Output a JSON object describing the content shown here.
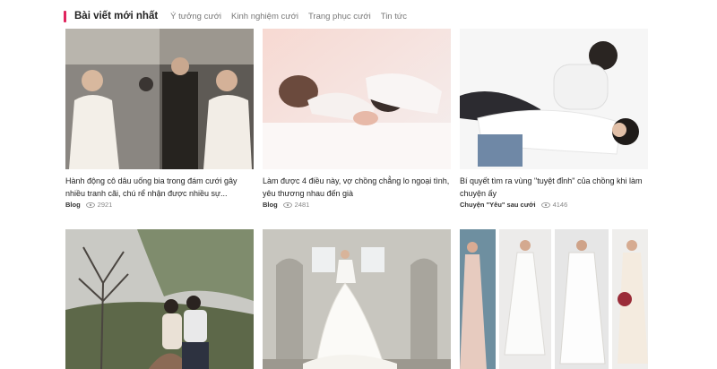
{
  "section": {
    "title": "Bài viết mới nhất",
    "tabs": [
      "Ý tưởng cưới",
      "Kinh nghiệm cưới",
      "Trang phục cưới",
      "Tin tức"
    ]
  },
  "articles": [
    {
      "title": "Hành động cô dâu uống bia trong đám cưới gây nhiều tranh cãi, chú rể nhận được nhiều sự...",
      "category": "Blog",
      "views": "2921"
    },
    {
      "title": "Làm được 4 điều này, vợ chồng chẳng lo ngoại tình, yêu thương nhau đến già",
      "category": "Blog",
      "views": "2481"
    },
    {
      "title": "Bí quyết tìm ra vùng \"tuyệt đỉnh\" của chồng khi làm chuyện ấy",
      "category": "Chuyện \"Yêu\" sau cưới",
      "views": "4146"
    },
    {
      "title": ""
    },
    {
      "title": ""
    },
    {
      "title": ""
    }
  ],
  "icons": {
    "views": "eye-icon"
  },
  "colors": {
    "accent": "#e0245e"
  }
}
